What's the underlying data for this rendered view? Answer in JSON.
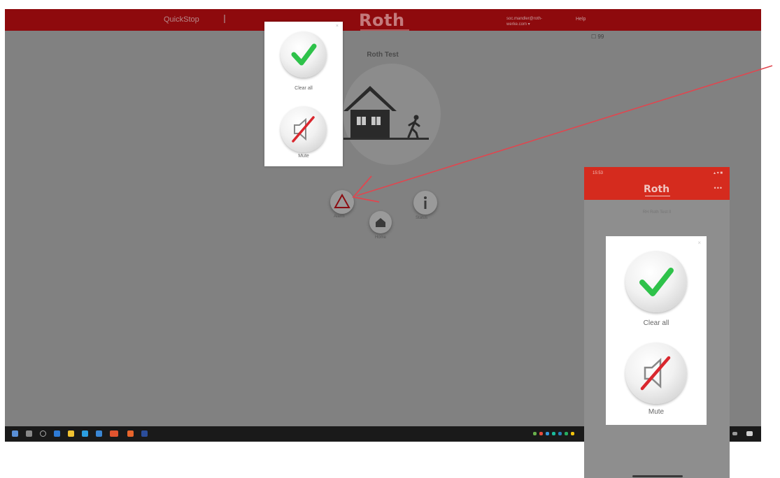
{
  "desktop": {
    "nav_left": "QuickStop",
    "logo": "Roth",
    "user_line1": "soc.mandler@roth-",
    "user_line2": "werke.com ▾",
    "help": "Help",
    "chat": "☐ 99"
  },
  "main": {
    "title": "Roth Test",
    "buttons": [
      {
        "label": "Alarm"
      },
      {
        "label": "Home"
      },
      {
        "label": "Status"
      }
    ]
  },
  "popup": {
    "close": "×",
    "clear_all": "Clear all",
    "mute": "Mute"
  },
  "phone": {
    "time": "15:53",
    "status": "▴ ▾ ■",
    "logo": "Roth",
    "more": "•••",
    "subtitle": "RH Roth Test II",
    "popup": {
      "close": "×",
      "clear_all": "Clear all",
      "mute": "Mute"
    }
  },
  "colors": {
    "header_red": "#8e0a0d",
    "phone_red": "#d52b1e",
    "check_green": "#2ec24a",
    "mute_slash": "#d9272e",
    "annotation_arrow": "#e0464f"
  },
  "icons": [
    "check-icon",
    "speaker-mute-icon",
    "house-icon",
    "walker-icon",
    "warning-triangle-icon",
    "info-icon",
    "chat-icon"
  ]
}
